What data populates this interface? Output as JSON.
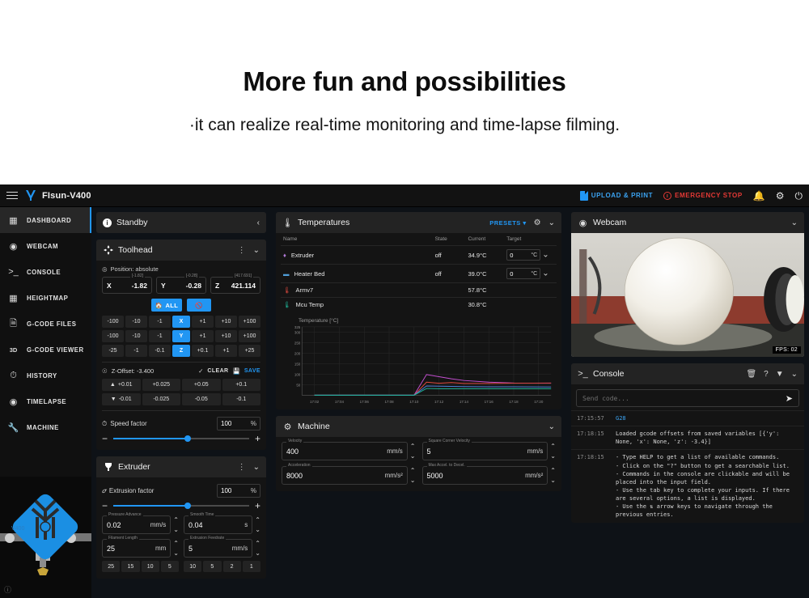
{
  "banner": {
    "title": "More fun and possibilities",
    "subtitle": "·it can realize real-time monitoring and time-lapse filming."
  },
  "topbar": {
    "app_title": "FIsun-V400",
    "menu_icon": "hamburger-icon",
    "logo_icon": "flsun-logo-icon",
    "upload_label": "UPLOAD & PRINT",
    "estop_label": "EMERGENCY STOP",
    "notification_icon": "bell-icon",
    "settings_icon": "gear-icon",
    "power_icon": "power-icon",
    "accent": "#2196f3",
    "danger": "#e53935"
  },
  "sidebar": {
    "items": [
      {
        "label": "DASHBOARD",
        "icon": "dashboard-icon",
        "active": true
      },
      {
        "label": "WEBCAM",
        "icon": "webcam-icon",
        "active": false
      },
      {
        "label": "CONSOLE",
        "icon": "console-icon",
        "active": false
      },
      {
        "label": "HEIGHTMAP",
        "icon": "grid-icon",
        "active": false
      },
      {
        "label": "G-CODE FILES",
        "icon": "file-icon",
        "active": false
      },
      {
        "label": "G-CODE VIEWER",
        "icon": "3d-icon",
        "active": false
      },
      {
        "label": "HISTORY",
        "icon": "clock-icon",
        "active": false
      },
      {
        "label": "TIMELAPSE",
        "icon": "timelapse-icon",
        "active": false
      },
      {
        "label": "MACHINE",
        "icon": "wrench-icon",
        "active": false
      }
    ]
  },
  "status_card": {
    "title": "Standby",
    "icon": "info-icon",
    "collapse_icon": "chevron-left-icon"
  },
  "toolhead": {
    "title": "Toolhead",
    "icon": "toolhead-icon",
    "position_label": "Position: absolute",
    "axes": [
      {
        "name": "X",
        "value": "-1.82",
        "cap": "[-1.82]"
      },
      {
        "name": "Y",
        "value": "-0.28",
        "cap": "[-0.28]"
      },
      {
        "name": "Z",
        "value": "421.114",
        "cap": "[417.691]"
      }
    ],
    "home_all_label": "ALL",
    "motors_off_icon": "motors-off-icon",
    "jog_rows": [
      {
        "axis": "X",
        "neg": [
          "-100",
          "-10",
          "-1"
        ],
        "pos": [
          "+1",
          "+10",
          "+100"
        ]
      },
      {
        "axis": "Y",
        "neg": [
          "-100",
          "-10",
          "-1"
        ],
        "pos": [
          "+1",
          "+10",
          "+100"
        ]
      },
      {
        "axis": "Z",
        "neg": [
          "-25",
          "-1",
          "-0.1"
        ],
        "pos": [
          "+0.1",
          "+1",
          "+25"
        ]
      }
    ],
    "zoffset_label": "Z-Offset: -3.400",
    "clear_label": "CLEAR",
    "save_label": "SAVE",
    "z_up": [
      "+0.01",
      "+0.025",
      "+0.05",
      "+0.1"
    ],
    "z_down": [
      "-0.01",
      "-0.025",
      "-0.05",
      "-0.1"
    ],
    "speed_factor_label": "Speed factor",
    "speed_factor_value": "100",
    "speed_factor_unit": "%",
    "speed_factor_percent": 55
  },
  "extruder": {
    "title": "Extruder",
    "icon": "extruder-icon",
    "extrusion_factor_label": "Extrusion factor",
    "extrusion_factor_value": "100",
    "extrusion_factor_unit": "%",
    "extrusion_factor_percent": 55,
    "fields": [
      {
        "label": "Pressure Advance",
        "value": "0.02",
        "unit": "mm/s"
      },
      {
        "label": "Smooth Time",
        "value": "0.04",
        "unit": "s"
      },
      {
        "label": "Filament Length",
        "value": "25",
        "unit": "mm"
      },
      {
        "label": "Extrusion Feedrate",
        "value": "5",
        "unit": "mm/s"
      }
    ],
    "length_presets": [
      "25",
      "15",
      "10",
      "5"
    ],
    "feedrate_presets": [
      "10",
      "5",
      "2",
      "1"
    ]
  },
  "temperatures": {
    "title": "Temperatures",
    "icon": "thermometer-icon",
    "presets_label": "PRESETS",
    "settings_icon": "gear-icon",
    "columns": [
      "Name",
      "State",
      "Current",
      "Target"
    ],
    "rows": [
      {
        "name": "Extruder",
        "icon": "extruder-temp-icon",
        "color": "#b07ad6",
        "state": "off",
        "current": "34.9°C",
        "target": "0",
        "target_unit": "°C",
        "has_target": true
      },
      {
        "name": "Heater Bed",
        "icon": "bed-temp-icon",
        "color": "#4f9ed9",
        "state": "off",
        "current": "39.0°C",
        "target": "0",
        "target_unit": "°C",
        "has_target": true
      },
      {
        "name": "Armv7",
        "icon": "sensor-icon",
        "color": "#e04a3f",
        "state": "",
        "current": "57.8°C",
        "target": "",
        "target_unit": "",
        "has_target": false
      },
      {
        "name": "Mcu Temp",
        "icon": "sensor-icon",
        "color": "#1fb89a",
        "state": "",
        "current": "30.8°C",
        "target": "",
        "target_unit": "",
        "has_target": false
      }
    ]
  },
  "chart_data": {
    "type": "line",
    "title": "Temperature [°C]",
    "xlabel": "",
    "ylabel": "Temperature [°C]",
    "ylim": [
      0,
      325
    ],
    "yticks": [
      325,
      300,
      250,
      200,
      150,
      100,
      50
    ],
    "xticks": [
      "17:02",
      "17:04",
      "17:06",
      "17:08",
      "17:10",
      "17:12",
      "17:14",
      "17:16",
      "17:18",
      "17:20"
    ],
    "grid": true,
    "legend": "none",
    "series": [
      {
        "name": "Extruder",
        "color": "#c44fd1",
        "x": [
          "17:02",
          "17:06",
          "17:10",
          "17:11",
          "17:12",
          "17:13",
          "17:14",
          "17:16",
          "17:18",
          "17:21"
        ],
        "values": [
          0,
          0,
          0,
          98,
          88,
          78,
          70,
          62,
          58,
          57
        ]
      },
      {
        "name": "Armv7",
        "color": "#e04a3f",
        "x": [
          "17:02",
          "17:06",
          "17:10",
          "17:11",
          "17:12",
          "17:13",
          "17:14",
          "17:16",
          "17:18",
          "17:21"
        ],
        "values": [
          0,
          0,
          0,
          62,
          57,
          60,
          56,
          56,
          57,
          58
        ]
      },
      {
        "name": "Heater Bed",
        "color": "#4f7fd9",
        "x": [
          "17:02",
          "17:06",
          "17:10",
          "17:11",
          "17:12",
          "17:13",
          "17:14",
          "17:16",
          "17:18",
          "17:21"
        ],
        "values": [
          0,
          0,
          0,
          44,
          43,
          42,
          41,
          40,
          40,
          39
        ]
      },
      {
        "name": "Mcu Temp",
        "color": "#1fb89a",
        "x": [
          "17:02",
          "17:06",
          "17:10",
          "17:11",
          "17:12",
          "17:13",
          "17:14",
          "17:16",
          "17:18",
          "17:21"
        ],
        "values": [
          0,
          0,
          0,
          32,
          31,
          31,
          31,
          31,
          31,
          31
        ]
      }
    ]
  },
  "machine": {
    "title": "Machine",
    "icon": "machine-icon",
    "fields": [
      {
        "label": "Velocity",
        "value": "400",
        "unit": "mm/s"
      },
      {
        "label": "Square Corner Velocity",
        "value": "5",
        "unit": "mm/s"
      },
      {
        "label": "Acceleration",
        "value": "8000",
        "unit": "mm/s²"
      },
      {
        "label": "Max Accel. to Decel.",
        "value": "5000",
        "unit": "mm/s²"
      }
    ]
  },
  "webcam": {
    "title": "Webcam",
    "icon": "webcam-icon",
    "fps_label": "FPS: 02"
  },
  "console": {
    "title": "Console",
    "icon": "console-icon",
    "toolbar_icons": [
      "clear-icon",
      "help-icon",
      "filter-icon",
      "chevron-down-icon"
    ],
    "input_placeholder": "Send code...",
    "send_icon": "send-icon",
    "entries": [
      {
        "ts": "17:15:57",
        "type": "command",
        "text": "G28"
      },
      {
        "ts": "17:18:15",
        "type": "message",
        "text": "Loaded gcode offsets from saved variables [{'y': None, 'x': None, 'z': -3.4}]"
      },
      {
        "ts": "17:18:15",
        "type": "help",
        "text": "- Type HELP to get a list of available commands.\n- Click on the \"?\" button to get a searchable list.\n- Commands in the console are clickable and will be placed into the input field.\n- Use the tab key to complete your inputs. If there are several options, a list is displayed.\n- Use the ⇅ arrow keys to navigate through the previous entries."
      }
    ]
  }
}
